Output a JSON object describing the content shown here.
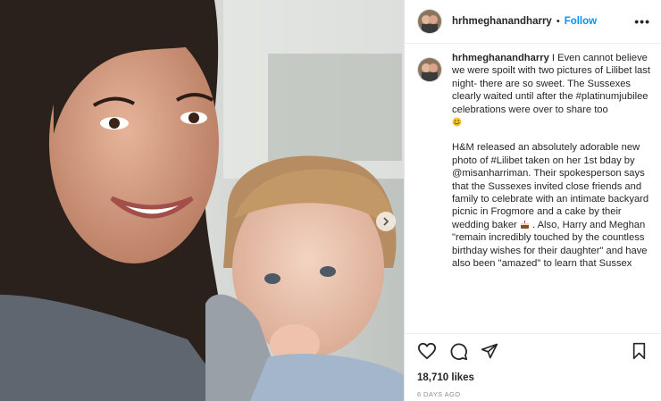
{
  "post": {
    "username": "hrhmeghanandharry",
    "dot": "•",
    "follow_label": "Follow",
    "more_label": "•••",
    "caption": {
      "username": "hrhmeghanandharry",
      "para1": "I Even cannot believe we were spoilt with two pictures of Lilibet last night- there are so sweet. The Sussexes clearly waited until after the #platinumjubilee celebrations were over to share too",
      "para2a": "H&M released an absolutely adorable new photo of #Lilibet taken on her 1st bday by @misanharriman. Their spokesperson says that the Sussexes invited close friends and family to celebrate with an intimate backyard picnic in Frogmore and a cake by their wedding baker",
      "para2b": ". Also, Harry and Meghan \"remain incredibly touched by the countless birthday wishes for their daughter\" and have also been \"amazed\" to learn that Sussex"
    },
    "likes": "18,710 likes",
    "time_ago": "6 DAYS AGO"
  },
  "icons": {
    "like": "heart-icon",
    "comment": "comment-icon",
    "share": "send-icon",
    "save": "bookmark-icon",
    "next": "chevron-right-icon",
    "emoji1": "smiling-face-emoji",
    "emoji2": "cake-emoji"
  },
  "colors": {
    "follow": "#0095f6",
    "text": "#262626",
    "muted": "#8e8e8e"
  }
}
